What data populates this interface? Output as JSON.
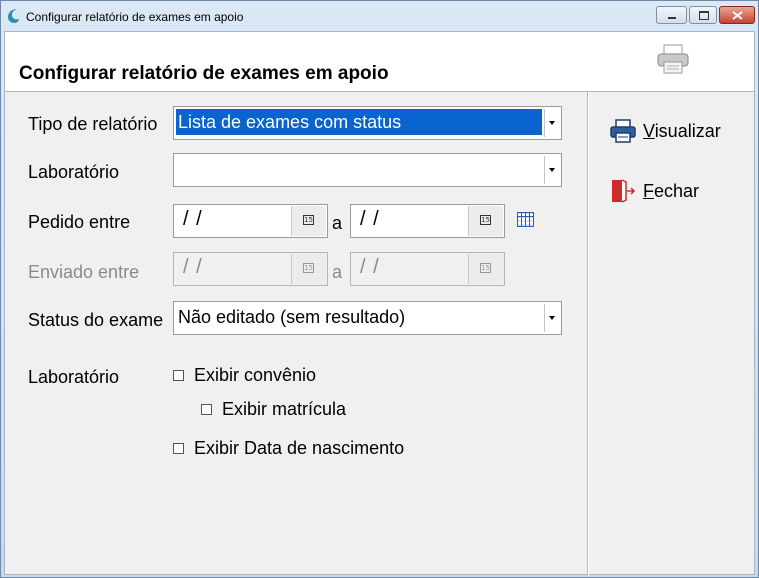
{
  "window": {
    "title": "Configurar relatório de exames em apoio"
  },
  "header": {
    "title": "Configurar relatório de exames em apoio"
  },
  "form": {
    "tipo_label": "Tipo de relatório",
    "tipo_value": "Lista de exames com status",
    "laboratorio_label": "Laboratório",
    "laboratorio_value": "",
    "pedido_label": "Pedido entre",
    "pedido_from": "/ /",
    "pedido_sep": "a",
    "pedido_to": "/ /",
    "enviado_label": "Enviado entre",
    "enviado_from": "/ /",
    "enviado_sep": "a",
    "enviado_to": "/ /",
    "status_label": "Status do exame",
    "status_value": "Não editado (sem resultado)",
    "lab_options_label": "Laboratório",
    "exibir_convenio": "Exibir convênio",
    "exibir_matricula": "Exibir matrícula",
    "exibir_nascimento": "Exibir Data de nascimento"
  },
  "actions": {
    "visualizar_u": "V",
    "visualizar_rest": "isualizar",
    "fechar_u": "F",
    "fechar_rest": "echar"
  },
  "calendar_glyph": "15",
  "colors": {
    "selection": "#0a64d0",
    "close_button": "#c4442f",
    "fechar_icon": "#d12a2a"
  }
}
